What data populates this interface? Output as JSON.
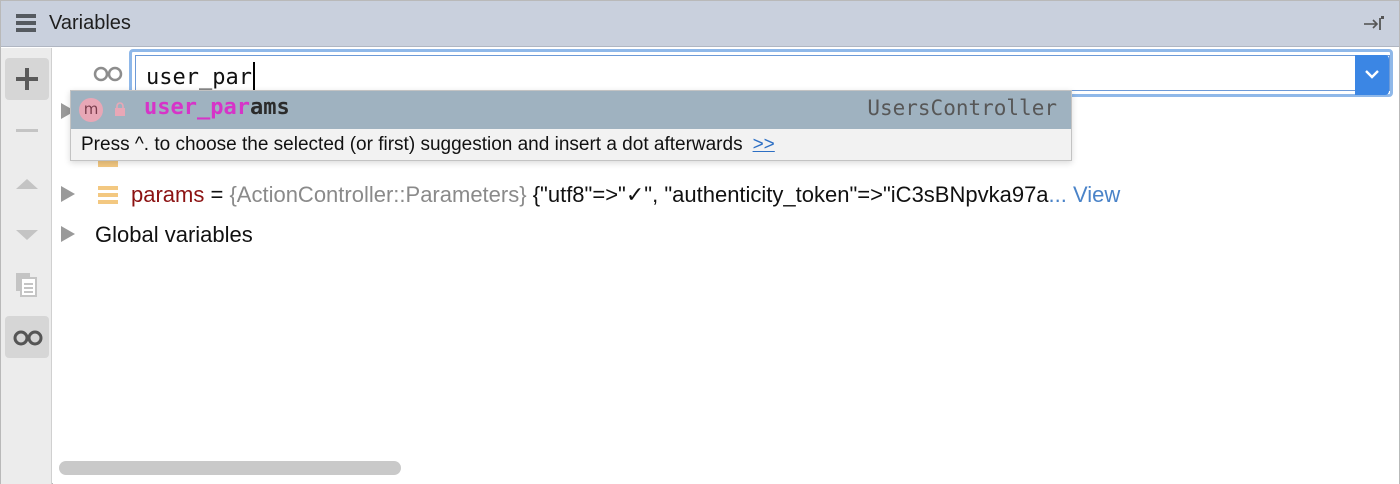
{
  "header": {
    "title": "Variables",
    "menu_icon": "hamburger-icon",
    "pin_icon": "hide-panel-icon"
  },
  "toolbar": {
    "buttons": [
      {
        "name": "add-watch-button",
        "icon": "plus-icon"
      },
      {
        "name": "remove-watch-button",
        "icon": "minus-icon"
      },
      {
        "name": "move-up-button",
        "icon": "triangle-up-icon"
      },
      {
        "name": "move-down-button",
        "icon": "triangle-down-icon"
      },
      {
        "name": "copy-button",
        "icon": "copy-icon"
      },
      {
        "name": "show-watches-button",
        "icon": "glasses-icon",
        "active": true
      }
    ]
  },
  "watch_input": {
    "value": "user_par",
    "icon": "glasses-icon"
  },
  "completion": {
    "item_icon": "method-icon",
    "item_icon_letter": "m",
    "match_text": "user_par",
    "rest_text": "ams",
    "type": "UsersController",
    "hint": "Press ^. to choose the selected (or first) suggestion and insert a dot afterwards",
    "hint_link": ">>"
  },
  "tree": {
    "rows": [
      {
        "name": "params",
        "eq": " = ",
        "type": "{ActionController::Parameters}",
        "value": " {\"utf8\"=>\"✓\", \"authenticity_token\"=>\"iC3sBNpvka97a",
        "ellipsis_link": "... View"
      },
      {
        "label": "Global variables"
      }
    ]
  },
  "colors": {
    "header_bg": "#c9d0dd",
    "selection_bg": "#9fb2c0",
    "match_color": "#d634c8",
    "accent": "#3b86e4"
  }
}
